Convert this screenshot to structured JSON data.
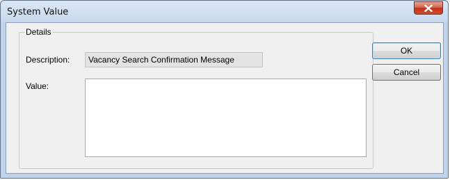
{
  "window": {
    "title": "System Value",
    "close_glyph": "X"
  },
  "details": {
    "group_label": "Details",
    "description_label": "Description:",
    "description_value": "Vacancy Search Confirmation Message",
    "value_label": "Value:",
    "value_text": ""
  },
  "buttons": {
    "ok_label": "OK",
    "cancel_label": "Cancel"
  },
  "icons": {
    "close": "close-icon"
  },
  "colors": {
    "titlebar": "#c8d9ee",
    "close_button": "#c1341c",
    "dialog_body": "#f0f0f0",
    "readonly_field": "#e3e3e3"
  }
}
